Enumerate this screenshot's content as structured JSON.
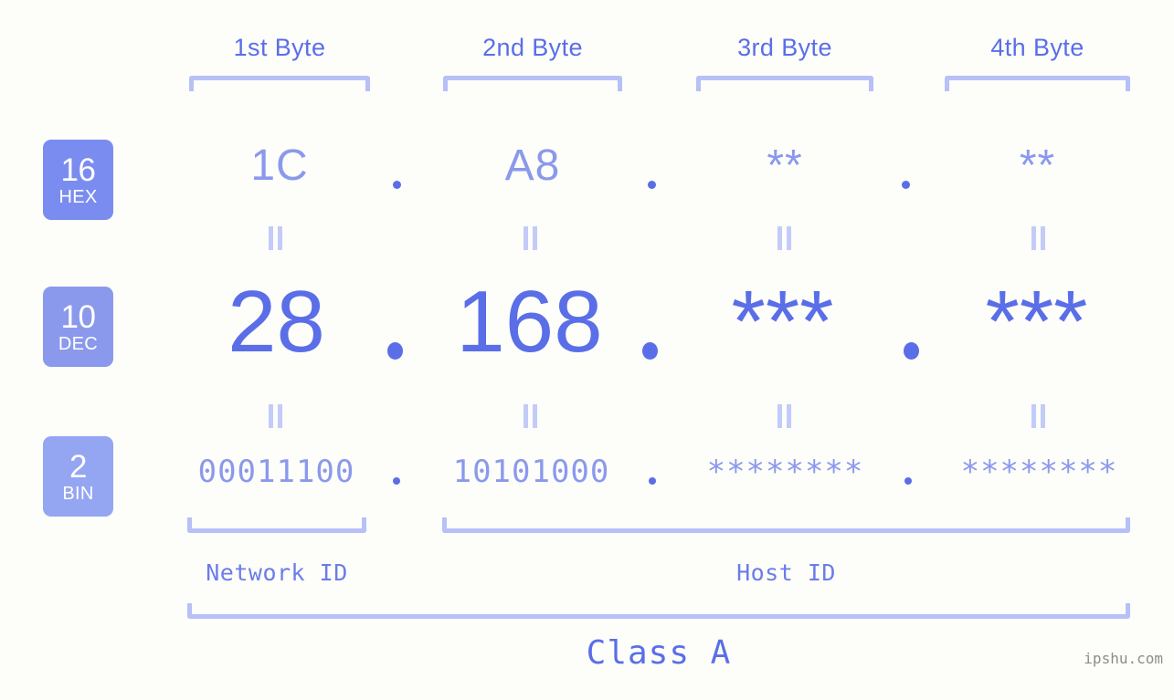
{
  "background": "#fdfdfa",
  "colors": {
    "accent_strong": "#5a6ee8",
    "accent_mid": "#8b99ec",
    "bracket": "#b7c0f7",
    "equals": "#c3cbf8",
    "badge_hex": "#7b8cf0",
    "badge_dec": "#8b99ec",
    "badge_bin": "#94a5f2",
    "watermark": "#8d8d8d"
  },
  "byte_headers": [
    {
      "label": "1st Byte"
    },
    {
      "label": "2nd Byte"
    },
    {
      "label": "3rd Byte"
    },
    {
      "label": "4th Byte"
    }
  ],
  "bases": [
    {
      "number": "16",
      "name": "HEX"
    },
    {
      "number": "10",
      "name": "DEC"
    },
    {
      "number": "2",
      "name": "BIN"
    }
  ],
  "separator": ".",
  "rows": {
    "hex": {
      "base": "16",
      "name": "HEX",
      "values": [
        "1C",
        "A8",
        "**",
        "**"
      ]
    },
    "dec": {
      "base": "10",
      "name": "DEC",
      "values": [
        "28",
        "168",
        "***",
        "***"
      ]
    },
    "bin": {
      "base": "2",
      "name": "BIN",
      "values": [
        "00011100",
        "10101000",
        "********",
        "********"
      ]
    }
  },
  "equals_mark": "=",
  "sections": [
    {
      "label": "Network ID"
    },
    {
      "label": "Host ID"
    }
  ],
  "class": {
    "label": "Class A"
  },
  "watermark": {
    "text": "ipshu.com"
  }
}
